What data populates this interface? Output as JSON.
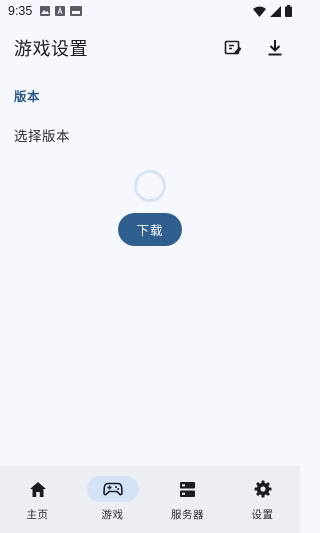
{
  "status_bar": {
    "time": "9:35"
  },
  "header": {
    "title": "游戏设置",
    "actions": [
      {
        "icon": "edit-document-icon"
      },
      {
        "icon": "download-icon"
      }
    ]
  },
  "section": {
    "header": "版本",
    "item_label": "选择版本"
  },
  "main": {
    "download_label": "下载"
  },
  "bottom_nav": {
    "items": [
      {
        "label": "主页",
        "icon": "home-icon",
        "active": false
      },
      {
        "label": "游戏",
        "icon": "gamepad-icon",
        "active": true
      },
      {
        "label": "服务器",
        "icon": "server-icon",
        "active": false
      },
      {
        "label": "设置",
        "icon": "gear-icon",
        "active": false
      }
    ]
  },
  "colors": {
    "accent": "#2f5f8e",
    "section_header": "#2d5a8c",
    "active_nav_pill": "#d5e3f6",
    "background": "#f7f8fd",
    "nav_background": "#eceef4"
  }
}
